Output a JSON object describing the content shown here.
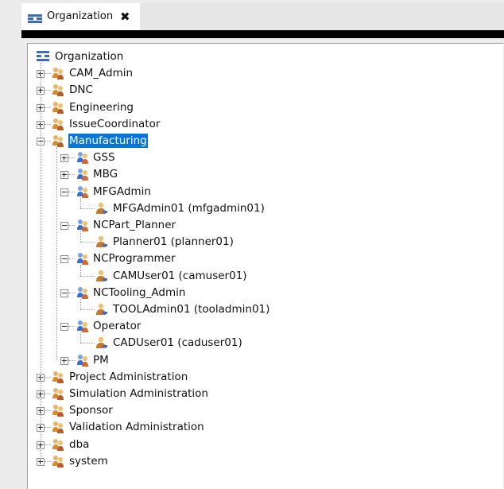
{
  "tab": {
    "title": "Organization",
    "close_glyph": "✖",
    "icon": "organization-icon"
  },
  "tree": {
    "root": {
      "label": "Organization",
      "icon": "organization-icon"
    },
    "groups": [
      {
        "label": "CAM_Admin",
        "state": "collapsed"
      },
      {
        "label": "DNC",
        "state": "collapsed"
      },
      {
        "label": "Engineering",
        "state": "collapsed"
      },
      {
        "label": "IssueCoordinator",
        "state": "collapsed"
      },
      {
        "label": "Manufacturing",
        "state": "expanded",
        "selected": true,
        "roles": [
          {
            "label": "GSS",
            "state": "collapsed"
          },
          {
            "label": "MBG",
            "state": "collapsed"
          },
          {
            "label": "MFGAdmin",
            "state": "expanded",
            "users": [
              "MFGAdmin01 (mfgadmin01)"
            ]
          },
          {
            "label": "NCPart_Planner",
            "state": "expanded",
            "users": [
              "Planner01 (planner01)"
            ]
          },
          {
            "label": "NCProgrammer",
            "state": "expanded",
            "users": [
              "CAMUser01 (camuser01)"
            ]
          },
          {
            "label": "NCTooling_Admin",
            "state": "expanded",
            "users": [
              "TOOLAdmin01 (tooladmin01)"
            ]
          },
          {
            "label": "Operator",
            "state": "expanded",
            "users": [
              "CADUser01 (caduser01)"
            ]
          },
          {
            "label": "PM",
            "state": "collapsed"
          }
        ]
      },
      {
        "label": "Project Administration",
        "state": "collapsed"
      },
      {
        "label": "Simulation Administration",
        "state": "collapsed"
      },
      {
        "label": "Sponsor",
        "state": "collapsed"
      },
      {
        "label": "Validation Administration",
        "state": "collapsed"
      },
      {
        "label": "dba",
        "state": "collapsed"
      },
      {
        "label": "system",
        "state": "collapsed"
      }
    ]
  },
  "colors": {
    "selection": "#0a74d8",
    "group_icon": "#d98b2b",
    "role_icon": "#3a6fd0",
    "user_icon": "#c8782a"
  }
}
